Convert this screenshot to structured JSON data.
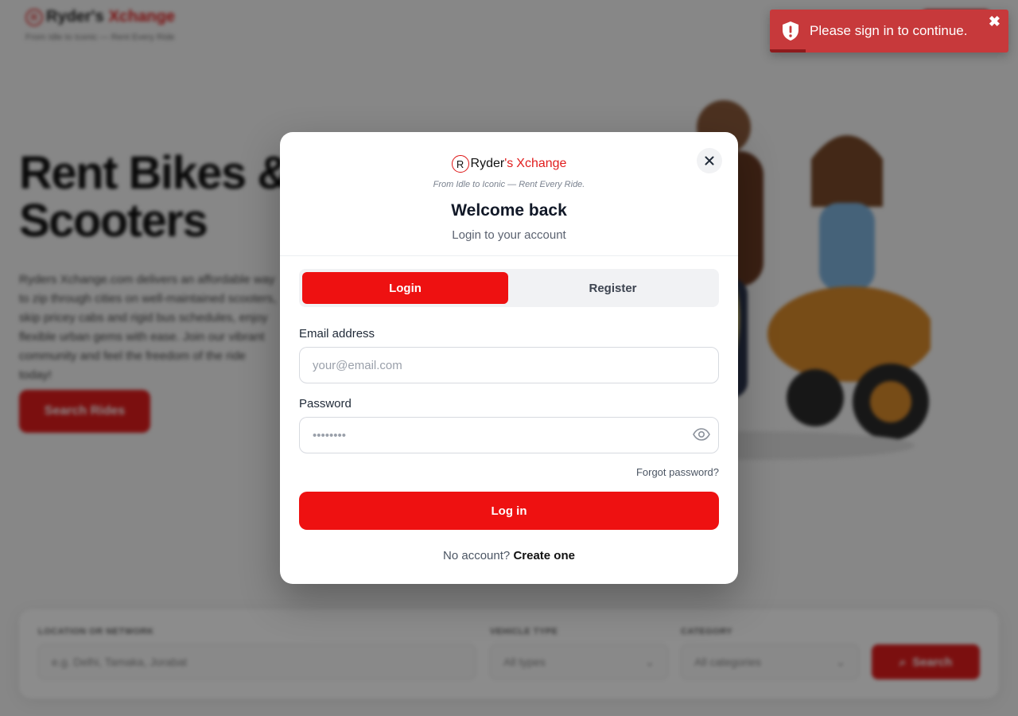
{
  "background": {
    "brand": {
      "prefix": "Ryder's",
      "suffix": "Xchange",
      "tagline": "From Idle to Iconic — Rent Every Ride"
    },
    "hero": {
      "title_line1": "Rent Bikes &",
      "title_line2": "Scooters",
      "description": "Ryders Xchange.com delivers an affordable way to zip through cities on well-maintained scooters, skip pricey cabs and rigid bus schedules, enjoy flexible urban gems with ease. Join our vibrant community and feel the freedom of the ride today!",
      "cta": "Search Rides"
    },
    "search": {
      "location_label": "LOCATION OR NETWORK",
      "location_placeholder": "e.g. Delhi, Tamaka, Jorabat",
      "vehicle_label": "VEHICLE TYPE",
      "vehicle_value": "All types",
      "category_label": "CATEGORY",
      "category_value": "All categories",
      "button": "Search"
    }
  },
  "toast": {
    "message": "Please sign in to continue.",
    "progress": 0.15
  },
  "modal": {
    "brand": {
      "r": "R",
      "name": "Ryder",
      "apostrophe": "'s",
      "x": "Xchange"
    },
    "tagline": "From Idle to Iconic — Rent Every Ride.",
    "title": "Welcome back",
    "subtitle": "Login to your account",
    "tabs": [
      {
        "label": "Login",
        "active": true
      },
      {
        "label": "Register",
        "active": false
      }
    ],
    "email": {
      "label": "Email address",
      "placeholder": "your@email.com"
    },
    "password": {
      "label": "Password",
      "placeholder": "••••••••"
    },
    "forgot": "Forgot password?",
    "submit": "Log in",
    "footer": {
      "question": "No account?",
      "link": "Create one"
    }
  },
  "colors": {
    "accent": "#ee1111",
    "toast_bg": "#c7393b"
  }
}
